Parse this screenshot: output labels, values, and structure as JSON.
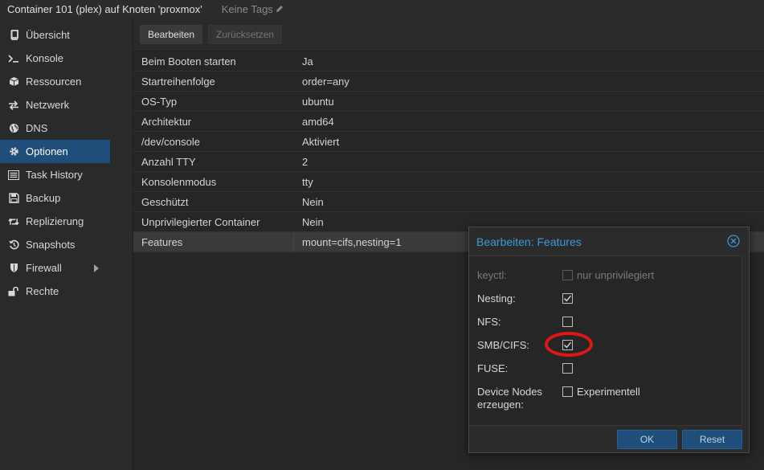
{
  "title": "Container 101 (plex) auf Knoten 'proxmox'",
  "tags": "Keine Tags",
  "sidebar": {
    "items": [
      {
        "label": "Übersicht",
        "icon": "book-icon"
      },
      {
        "label": "Konsole",
        "icon": "terminal-icon"
      },
      {
        "label": "Ressourcen",
        "icon": "cube-icon"
      },
      {
        "label": "Netzwerk",
        "icon": "exchange-icon"
      },
      {
        "label": "DNS",
        "icon": "globe-icon"
      },
      {
        "label": "Optionen",
        "icon": "gear-icon"
      },
      {
        "label": "Task History",
        "icon": "list-icon"
      },
      {
        "label": "Backup",
        "icon": "floppy-icon"
      },
      {
        "label": "Replizierung",
        "icon": "retweet-icon"
      },
      {
        "label": "Snapshots",
        "icon": "history-icon"
      },
      {
        "label": "Firewall",
        "icon": "shield-icon"
      },
      {
        "label": "Rechte",
        "icon": "unlock-icon"
      }
    ],
    "active_index": 5
  },
  "toolbar": {
    "edit_label": "Bearbeiten",
    "reset_label": "Zurücksetzen"
  },
  "options": [
    {
      "key": "Beim Booten starten",
      "value": "Ja"
    },
    {
      "key": "Startreihenfolge",
      "value": "order=any"
    },
    {
      "key": "OS-Typ",
      "value": "ubuntu"
    },
    {
      "key": "Architektur",
      "value": "amd64"
    },
    {
      "key": "/dev/console",
      "value": "Aktiviert"
    },
    {
      "key": "Anzahl TTY",
      "value": "2"
    },
    {
      "key": "Konsolenmodus",
      "value": "tty"
    },
    {
      "key": "Geschützt",
      "value": "Nein"
    },
    {
      "key": "Unprivilegierter Container",
      "value": "Nein"
    },
    {
      "key": "Features",
      "value": "mount=cifs,nesting=1"
    }
  ],
  "dialog": {
    "title": "Bearbeiten: Features",
    "fields": {
      "keyctl": {
        "label": "keyctl:",
        "checked": false,
        "disabled": true,
        "box_label": "nur unprivilegiert"
      },
      "nesting": {
        "label": "Nesting:",
        "checked": true
      },
      "nfs": {
        "label": "NFS:",
        "checked": false
      },
      "smb": {
        "label": "SMB/CIFS:",
        "checked": true
      },
      "fuse": {
        "label": "FUSE:",
        "checked": false
      },
      "devnodes": {
        "label": "Device Nodes erzeugen:",
        "checked": false,
        "box_label": "Experimentell"
      }
    },
    "ok_label": "OK",
    "reset_label": "Reset"
  },
  "colors": {
    "accent": "#3a9bd9",
    "active_bg": "#1f4e7a",
    "highlight": "#e01616"
  }
}
